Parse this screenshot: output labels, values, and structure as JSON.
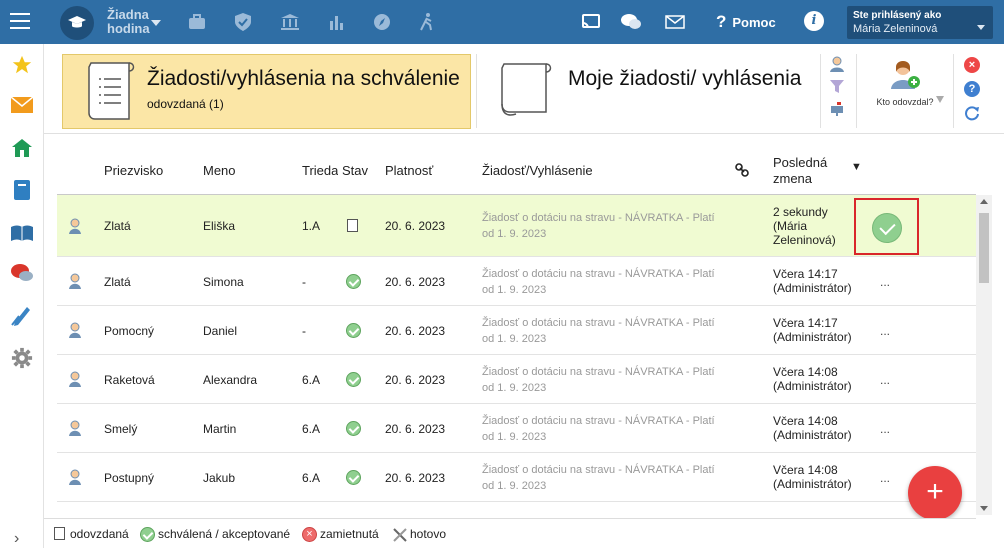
{
  "topbar": {
    "hour_line1": "Žiadna",
    "hour_line2": "hodina",
    "help_label": "Pomoc",
    "help_glyph": "?",
    "info_glyph": "i",
    "user_caption": "Ste prihlásený ako",
    "user_name": "Mária Zeleninová",
    "icons": [
      "school-bag-icon",
      "shield-icon",
      "building-icon",
      "bar-chart-icon",
      "compass-icon",
      "hiking-icon",
      "cast-icon",
      "chat-icon",
      "mail-icon"
    ],
    "color": "#2f6ea5"
  },
  "leftnav": {
    "icons": [
      "star-icon",
      "envelope-icon",
      "home-icon",
      "book-icon",
      "open-book-icon",
      "messages-icon",
      "pen-icon",
      "gear-icon"
    ],
    "expand_glyph": "›"
  },
  "header": {
    "active_card": {
      "title": "Žiadosti/vyhlásenia na schválenie",
      "subtitle": "odovzdaná (1)"
    },
    "second_card": {
      "title": "Moje žiadosti/ vyhlásenia"
    },
    "who_submitted_label": "Kto odovzdal?",
    "help_glyph": "?"
  },
  "table": {
    "columns": {
      "surname": "Priezvisko",
      "name": "Meno",
      "class": "Trieda",
      "status": "Stav",
      "validity": "Platnosť",
      "request": "Žiadosť/Vyhlásenie",
      "last_change_1": "Posledná",
      "last_change_2": "zmena",
      "sort_glyph": "▼"
    },
    "rows": [
      {
        "surname": "Zlatá",
        "name": "Eliška",
        "class": "1.A",
        "status": "odovzdana",
        "validity": "20. 6. 2023",
        "req1": "Žiadosť o dotáciu na stravu - NÁVRATKA - Platí",
        "req2": "od 1. 9. 2023",
        "chg1": "2 sekundy",
        "chg2": "(Mária",
        "chg3": "Zeleninová)",
        "more": ""
      },
      {
        "surname": "Zlatá",
        "name": "Simona",
        "class": "-",
        "status": "schvalena",
        "validity": "20. 6. 2023",
        "req1": "Žiadosť o dotáciu na stravu - NÁVRATKA - Platí",
        "req2": "od 1. 9. 2023",
        "chg1": "Včera 14:17",
        "chg2": "(Administrátor)",
        "more": "..."
      },
      {
        "surname": "Pomocný",
        "name": "Daniel",
        "class": "-",
        "status": "schvalena",
        "validity": "20. 6. 2023",
        "req1": "Žiadosť o dotáciu na stravu - NÁVRATKA - Platí",
        "req2": "od 1. 9. 2023",
        "chg1": "Včera 14:17",
        "chg2": "(Administrátor)",
        "more": "..."
      },
      {
        "surname": "Raketová",
        "name": "Alexandra",
        "class": "6.A",
        "status": "schvalena",
        "validity": "20. 6. 2023",
        "req1": "Žiadosť o dotáciu na stravu - NÁVRATKA - Platí",
        "req2": "od 1. 9. 2023",
        "chg1": "Včera 14:08",
        "chg2": "(Administrátor)",
        "more": "..."
      },
      {
        "surname": "Smelý",
        "name": "Martin",
        "class": "6.A",
        "status": "schvalena",
        "validity": "20. 6. 2023",
        "req1": "Žiadosť o dotáciu na stravu - NÁVRATKA - Platí",
        "req2": "od 1. 9. 2023",
        "chg1": "Včera 14:08",
        "chg2": "(Administrátor)",
        "more": "..."
      },
      {
        "surname": "Postupný",
        "name": "Jakub",
        "class": "6.A",
        "status": "schvalena",
        "validity": "20. 6. 2023",
        "req1": "Žiadosť o dotáciu na stravu - NÁVRATKA - Platí",
        "req2": "od 1. 9. 2023",
        "chg1": "Včera 14:08",
        "chg2": "(Administrátor)",
        "more": "..."
      }
    ]
  },
  "fab_label": "+",
  "legend": {
    "submitted": "odovzdaná",
    "approved": "schválená / akceptované",
    "rejected": "zamietnutá",
    "done": "hotovo"
  }
}
